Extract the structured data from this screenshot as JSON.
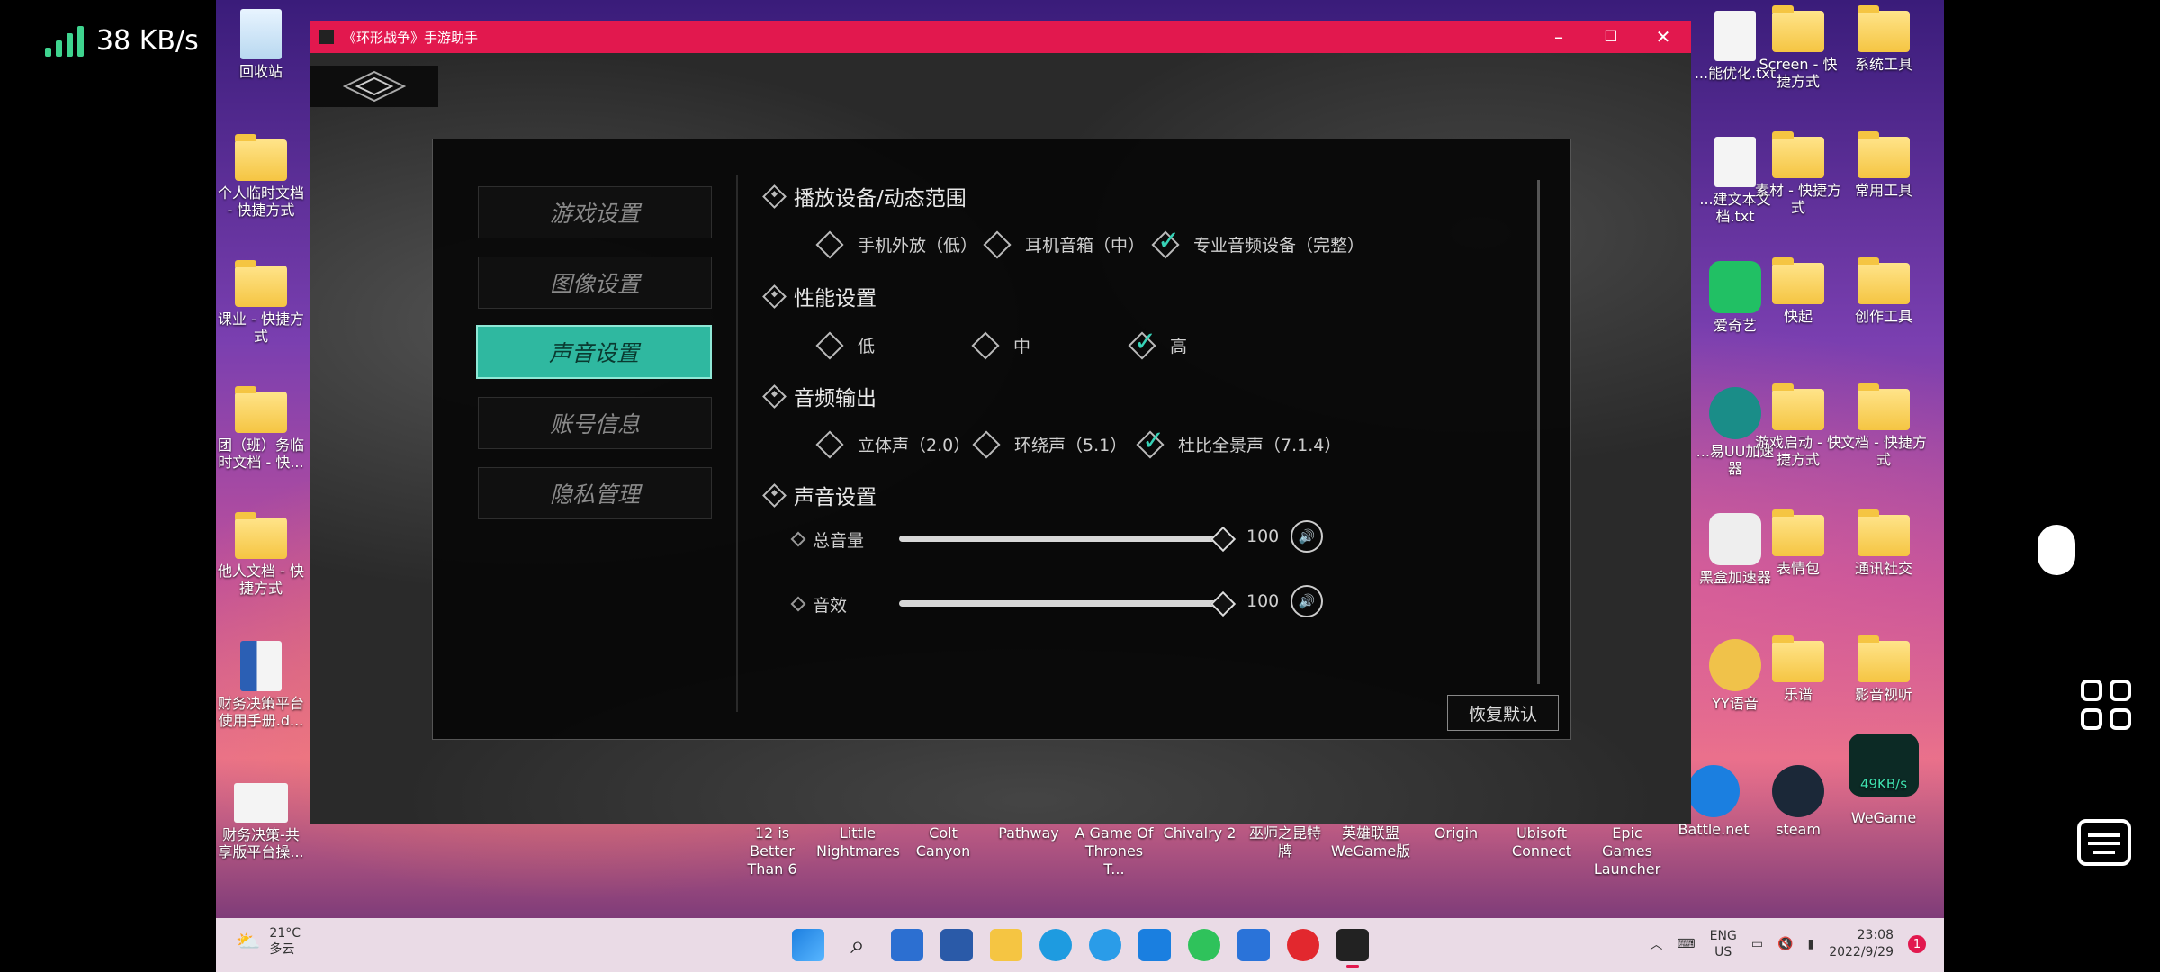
{
  "status": {
    "net_speed": "38 KB/s"
  },
  "desktop_left": [
    {
      "label": "回收站"
    },
    {
      "label": "个人临时文档 - 快捷方式"
    },
    {
      "label": "课业 - 快捷方式"
    },
    {
      "label": "团（班）务临时文档 - 快..."
    },
    {
      "label": "他人文档 - 快捷方式"
    },
    {
      "label": "财务决策平台使用手册.d..."
    },
    {
      "label": "财务决策-共享版平台操..."
    }
  ],
  "desktop_right": [
    {
      "label": "...能优化.txt"
    },
    {
      "label": "Screen - 快捷方式"
    },
    {
      "label": "系统工具"
    },
    {
      "label": "...建文本文档.txt"
    },
    {
      "label": "素材 - 快捷方式"
    },
    {
      "label": "常用工具"
    },
    {
      "label": "爱奇艺"
    },
    {
      "label": "快起"
    },
    {
      "label": "创作工具"
    },
    {
      "label": "...易UU加速器"
    },
    {
      "label": "游戏启动 - 快捷方式"
    },
    {
      "label": "文档 - 快捷方式"
    },
    {
      "label": "黑盒加速器"
    },
    {
      "label": "表情包"
    },
    {
      "label": "通讯社交"
    },
    {
      "label": "YY语音"
    },
    {
      "label": "乐谱"
    },
    {
      "label": "影音视听"
    },
    {
      "label": "Battle.net"
    },
    {
      "label": "steam"
    },
    {
      "label": "WeGame"
    }
  ],
  "wegame_speed": "49KB/s",
  "game_shortcuts": [
    "12 is Better Than 6",
    "Little Nightmares",
    "Colt Canyon",
    "Pathway",
    "A Game Of Thrones T...",
    "Chivalry 2",
    "巫师之昆特牌",
    "英雄联盟 WeGame版",
    "Origin",
    "Ubisoft Connect",
    "Epic Games Launcher"
  ],
  "window": {
    "title": "《环形战争》手游助手"
  },
  "menu": [
    {
      "label": "游戏设置",
      "active": false
    },
    {
      "label": "图像设置",
      "active": false
    },
    {
      "label": "声音设置",
      "active": true
    },
    {
      "label": "账号信息",
      "active": false
    },
    {
      "label": "隐私管理",
      "active": false
    }
  ],
  "sections": {
    "playback": {
      "title": "播放设备/动态范围",
      "options": [
        {
          "label": "手机外放（低）",
          "checked": false
        },
        {
          "label": "耳机音箱（中）",
          "checked": false
        },
        {
          "label": "专业音频设备（完整）",
          "checked": true
        }
      ]
    },
    "performance": {
      "title": "性能设置",
      "options": [
        {
          "label": "低",
          "checked": false
        },
        {
          "label": "中",
          "checked": false
        },
        {
          "label": "高",
          "checked": true
        }
      ]
    },
    "output": {
      "title": "音频输出",
      "options": [
        {
          "label": "立体声（2.0）",
          "checked": false
        },
        {
          "label": "环绕声（5.1）",
          "checked": false
        },
        {
          "label": "杜比全景声（7.1.4）",
          "checked": true
        }
      ]
    },
    "sound": {
      "title": "声音设置",
      "sliders": [
        {
          "label": "总音量",
          "value": "100",
          "fraction": 1.0
        },
        {
          "label": "音效",
          "value": "100",
          "fraction": 1.0
        }
      ]
    }
  },
  "reset_label": "恢复默认",
  "weather": {
    "temp": "21°C",
    "desc": "多云"
  },
  "tray": {
    "lang1": "ENG",
    "lang2": "US",
    "time": "23:08",
    "date": "2022/9/29",
    "notifications": "1"
  },
  "colors": {
    "accent": "#2fb8a0",
    "check": "#37d2b7",
    "titlebar": "#e2184e"
  }
}
